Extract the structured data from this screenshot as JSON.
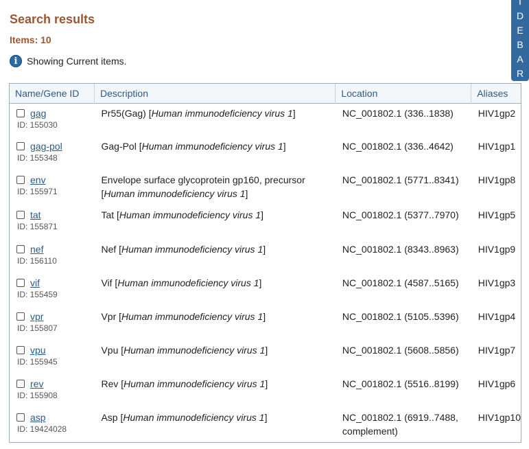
{
  "header": {
    "title": "Search results",
    "items_count": "Items: 10",
    "notice": "Showing Current items."
  },
  "sidebar_tab": {
    "letters": [
      "I",
      "D",
      "E",
      "B",
      "A",
      "R"
    ]
  },
  "table": {
    "columns": [
      "Name/Gene ID",
      "Description",
      "Location",
      "Aliases"
    ],
    "rows": [
      {
        "name": "gag",
        "id": "ID: 155030",
        "desc_main": "Pr55(Gag) [",
        "desc_species": "Human immunodeficiency virus 1",
        "desc_end": "]",
        "location": "NC_001802.1 (336..1838)",
        "alias": "HIV1gp2"
      },
      {
        "name": "gag-pol",
        "id": "ID: 155348",
        "desc_main": "Gag-Pol [",
        "desc_species": "Human immunodeficiency virus 1",
        "desc_end": "]",
        "location": "NC_001802.1 (336..4642)",
        "alias": "HIV1gp1"
      },
      {
        "name": "env",
        "id": "ID: 155971",
        "desc_main": "Envelope surface glycoprotein gp160, precursor [",
        "desc_species": "Human immunodeficiency virus 1",
        "desc_end": "]",
        "location": "NC_001802.1 (5771..8341)",
        "alias": "HIV1gp8"
      },
      {
        "name": "tat",
        "id": "ID: 155871",
        "desc_main": "Tat [",
        "desc_species": "Human immunodeficiency virus 1",
        "desc_end": "]",
        "location": "NC_001802.1 (5377..7970)",
        "alias": "HIV1gp5"
      },
      {
        "name": "nef",
        "id": "ID: 156110",
        "desc_main": "Nef [",
        "desc_species": "Human immunodeficiency virus 1",
        "desc_end": "]",
        "location": "NC_001802.1 (8343..8963)",
        "alias": "HIV1gp9"
      },
      {
        "name": "vif",
        "id": "ID: 155459",
        "desc_main": "Vif [",
        "desc_species": "Human immunodeficiency virus 1",
        "desc_end": "]",
        "location": "NC_001802.1 (4587..5165)",
        "alias": "HIV1gp3"
      },
      {
        "name": "vpr",
        "id": "ID: 155807",
        "desc_main": "Vpr [",
        "desc_species": "Human immunodeficiency virus 1",
        "desc_end": "]",
        "location": "NC_001802.1 (5105..5396)",
        "alias": "HIV1gp4"
      },
      {
        "name": "vpu",
        "id": "ID: 155945",
        "desc_main": "Vpu [",
        "desc_species": "Human immunodeficiency virus 1",
        "desc_end": "]",
        "location": "NC_001802.1 (5608..5856)",
        "alias": "HIV1gp7"
      },
      {
        "name": "rev",
        "id": "ID: 155908",
        "desc_main": "Rev [",
        "desc_species": "Human immunodeficiency virus 1",
        "desc_end": "]",
        "location": "NC_001802.1 (5516..8199)",
        "alias": "HIV1gp6"
      },
      {
        "name": "asp",
        "id": "ID: 19424028",
        "desc_main": "Asp [",
        "desc_species": "Human immunodeficiency virus 1",
        "desc_end": "]",
        "location": "NC_001802.1 (6919..7488, complement)",
        "alias": "HIV1gp10"
      }
    ]
  },
  "colors": {
    "title": "#985735",
    "link": "#2a5a8a",
    "info_icon": "#2d6ba7",
    "sidebar_tab": "#326aa0",
    "table_border": "#97b0c8"
  },
  "icons": {
    "info": "info-icon",
    "checkbox": "checkbox"
  }
}
